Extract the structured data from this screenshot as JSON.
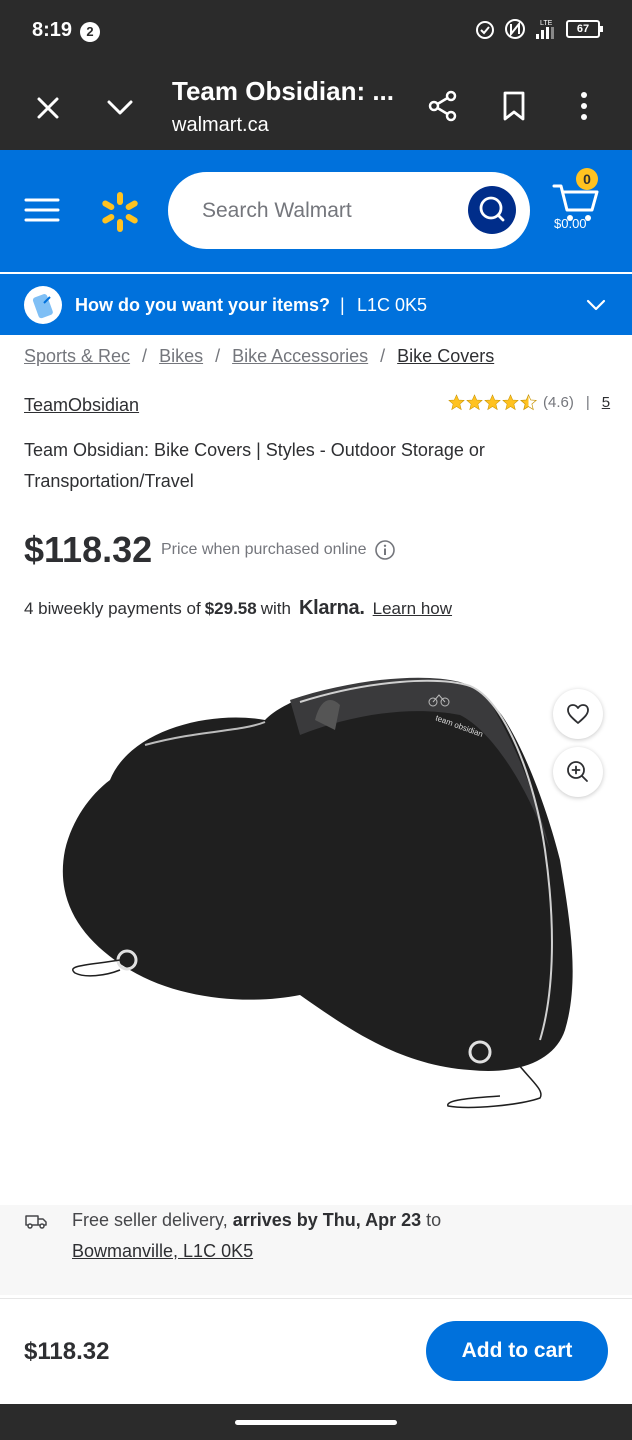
{
  "status_bar": {
    "time": "8:19",
    "notification_count": "2",
    "network": "LTE",
    "battery": "67"
  },
  "browser": {
    "title": "Team Obsidian: ...",
    "url": "walmart.ca"
  },
  "header": {
    "search_placeholder": "Search Walmart",
    "cart_count": "0",
    "cart_total": "$0.00",
    "brand_color": "#0071dc",
    "accent_color": "#ffc220"
  },
  "fulfillment": {
    "prompt": "How do you want your items?",
    "separator": "|",
    "postal_code": "L1C 0K5"
  },
  "breadcrumb": {
    "items": [
      "Sports & Rec",
      "Bikes",
      "Bike Accessories",
      "Bike Covers"
    ],
    "separator": "/"
  },
  "product": {
    "brand": "TeamObsidian",
    "rating": "(4.6)",
    "rating_stars": 4.5,
    "rating_separator": "|",
    "review_count": "5",
    "title": "Team Obsidian: Bike Covers | Styles - Outdoor Storage or Transportation/Travel",
    "price": "$118.32",
    "price_note": "Price when purchased online",
    "image_alt": "team obsidian"
  },
  "klarna": {
    "prefix": "4 biweekly payments of",
    "amount": "$29.58",
    "with": "with",
    "logo": "Klarna.",
    "link": "Learn how"
  },
  "delivery": {
    "prefix": "Free seller delivery,",
    "arrives": "arrives by Thu, Apr 23",
    "to": "to",
    "location": "Bowmanville, L1C 0K5"
  },
  "bottom_bar": {
    "price": "$118.32",
    "add_to_cart": "Add to cart"
  }
}
